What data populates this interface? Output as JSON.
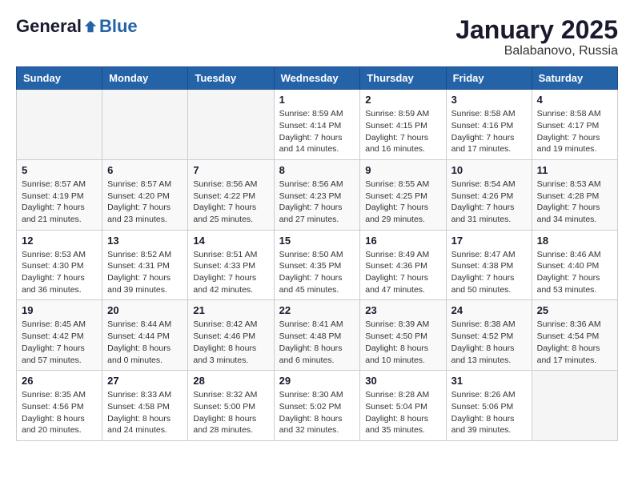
{
  "header": {
    "logo_general": "General",
    "logo_blue": "Blue",
    "title": "January 2025",
    "subtitle": "Balabanovo, Russia"
  },
  "days_of_week": [
    "Sunday",
    "Monday",
    "Tuesday",
    "Wednesday",
    "Thursday",
    "Friday",
    "Saturday"
  ],
  "weeks": [
    [
      {
        "day": "",
        "info": ""
      },
      {
        "day": "",
        "info": ""
      },
      {
        "day": "",
        "info": ""
      },
      {
        "day": "1",
        "info": "Sunrise: 8:59 AM\nSunset: 4:14 PM\nDaylight: 7 hours\nand 14 minutes."
      },
      {
        "day": "2",
        "info": "Sunrise: 8:59 AM\nSunset: 4:15 PM\nDaylight: 7 hours\nand 16 minutes."
      },
      {
        "day": "3",
        "info": "Sunrise: 8:58 AM\nSunset: 4:16 PM\nDaylight: 7 hours\nand 17 minutes."
      },
      {
        "day": "4",
        "info": "Sunrise: 8:58 AM\nSunset: 4:17 PM\nDaylight: 7 hours\nand 19 minutes."
      }
    ],
    [
      {
        "day": "5",
        "info": "Sunrise: 8:57 AM\nSunset: 4:19 PM\nDaylight: 7 hours\nand 21 minutes."
      },
      {
        "day": "6",
        "info": "Sunrise: 8:57 AM\nSunset: 4:20 PM\nDaylight: 7 hours\nand 23 minutes."
      },
      {
        "day": "7",
        "info": "Sunrise: 8:56 AM\nSunset: 4:22 PM\nDaylight: 7 hours\nand 25 minutes."
      },
      {
        "day": "8",
        "info": "Sunrise: 8:56 AM\nSunset: 4:23 PM\nDaylight: 7 hours\nand 27 minutes."
      },
      {
        "day": "9",
        "info": "Sunrise: 8:55 AM\nSunset: 4:25 PM\nDaylight: 7 hours\nand 29 minutes."
      },
      {
        "day": "10",
        "info": "Sunrise: 8:54 AM\nSunset: 4:26 PM\nDaylight: 7 hours\nand 31 minutes."
      },
      {
        "day": "11",
        "info": "Sunrise: 8:53 AM\nSunset: 4:28 PM\nDaylight: 7 hours\nand 34 minutes."
      }
    ],
    [
      {
        "day": "12",
        "info": "Sunrise: 8:53 AM\nSunset: 4:30 PM\nDaylight: 7 hours\nand 36 minutes."
      },
      {
        "day": "13",
        "info": "Sunrise: 8:52 AM\nSunset: 4:31 PM\nDaylight: 7 hours\nand 39 minutes."
      },
      {
        "day": "14",
        "info": "Sunrise: 8:51 AM\nSunset: 4:33 PM\nDaylight: 7 hours\nand 42 minutes."
      },
      {
        "day": "15",
        "info": "Sunrise: 8:50 AM\nSunset: 4:35 PM\nDaylight: 7 hours\nand 45 minutes."
      },
      {
        "day": "16",
        "info": "Sunrise: 8:49 AM\nSunset: 4:36 PM\nDaylight: 7 hours\nand 47 minutes."
      },
      {
        "day": "17",
        "info": "Sunrise: 8:47 AM\nSunset: 4:38 PM\nDaylight: 7 hours\nand 50 minutes."
      },
      {
        "day": "18",
        "info": "Sunrise: 8:46 AM\nSunset: 4:40 PM\nDaylight: 7 hours\nand 53 minutes."
      }
    ],
    [
      {
        "day": "19",
        "info": "Sunrise: 8:45 AM\nSunset: 4:42 PM\nDaylight: 7 hours\nand 57 minutes."
      },
      {
        "day": "20",
        "info": "Sunrise: 8:44 AM\nSunset: 4:44 PM\nDaylight: 8 hours\nand 0 minutes."
      },
      {
        "day": "21",
        "info": "Sunrise: 8:42 AM\nSunset: 4:46 PM\nDaylight: 8 hours\nand 3 minutes."
      },
      {
        "day": "22",
        "info": "Sunrise: 8:41 AM\nSunset: 4:48 PM\nDaylight: 8 hours\nand 6 minutes."
      },
      {
        "day": "23",
        "info": "Sunrise: 8:39 AM\nSunset: 4:50 PM\nDaylight: 8 hours\nand 10 minutes."
      },
      {
        "day": "24",
        "info": "Sunrise: 8:38 AM\nSunset: 4:52 PM\nDaylight: 8 hours\nand 13 minutes."
      },
      {
        "day": "25",
        "info": "Sunrise: 8:36 AM\nSunset: 4:54 PM\nDaylight: 8 hours\nand 17 minutes."
      }
    ],
    [
      {
        "day": "26",
        "info": "Sunrise: 8:35 AM\nSunset: 4:56 PM\nDaylight: 8 hours\nand 20 minutes."
      },
      {
        "day": "27",
        "info": "Sunrise: 8:33 AM\nSunset: 4:58 PM\nDaylight: 8 hours\nand 24 minutes."
      },
      {
        "day": "28",
        "info": "Sunrise: 8:32 AM\nSunset: 5:00 PM\nDaylight: 8 hours\nand 28 minutes."
      },
      {
        "day": "29",
        "info": "Sunrise: 8:30 AM\nSunset: 5:02 PM\nDaylight: 8 hours\nand 32 minutes."
      },
      {
        "day": "30",
        "info": "Sunrise: 8:28 AM\nSunset: 5:04 PM\nDaylight: 8 hours\nand 35 minutes."
      },
      {
        "day": "31",
        "info": "Sunrise: 8:26 AM\nSunset: 5:06 PM\nDaylight: 8 hours\nand 39 minutes."
      },
      {
        "day": "",
        "info": ""
      }
    ]
  ]
}
